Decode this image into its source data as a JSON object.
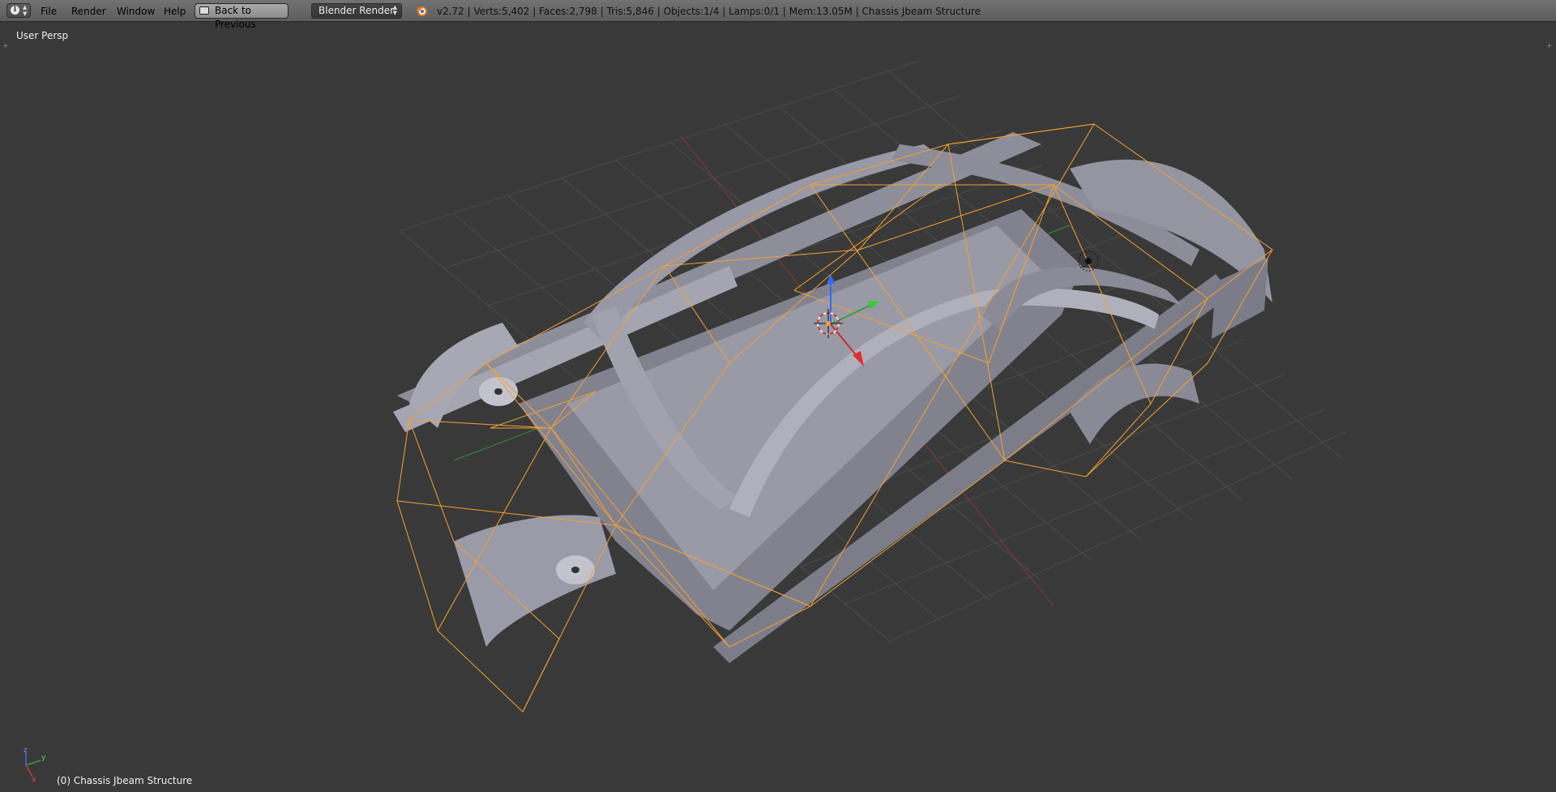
{
  "header": {
    "editor_type_icon": "info-icon",
    "menus": [
      "File",
      "Render",
      "Window",
      "Help"
    ],
    "back_button_label": "Back to Previous",
    "render_engine": "Blender Render",
    "stats": "v2.72 | Verts:5,402 | Faces:2,798 | Tris:5,846 | Objects:1/4 | Lamps:0/1 | Mem:13.05M | Chassis Jbeam Structure"
  },
  "viewport": {
    "view_name": "User Persp",
    "object_info": "(0) Chassis Jbeam Structure",
    "axis_labels": {
      "y": "y",
      "z": "z",
      "x": "x"
    }
  },
  "colors": {
    "header_bg": "#6b6b6b",
    "viewport_bg": "#393939",
    "mesh": "#8b8b99",
    "wire_selected": "#f5a030",
    "grid": "#4a4a4a",
    "axis_x": "#b13a3a",
    "axis_y": "#3c9a3c",
    "axis_z": "#2e6bff"
  },
  "icons": [
    "info-icon",
    "back-icon",
    "blender-logo-icon",
    "3d-cursor-icon",
    "lamp-icon",
    "axis-gizmo-icon",
    "transform-manipulator-icon"
  ]
}
